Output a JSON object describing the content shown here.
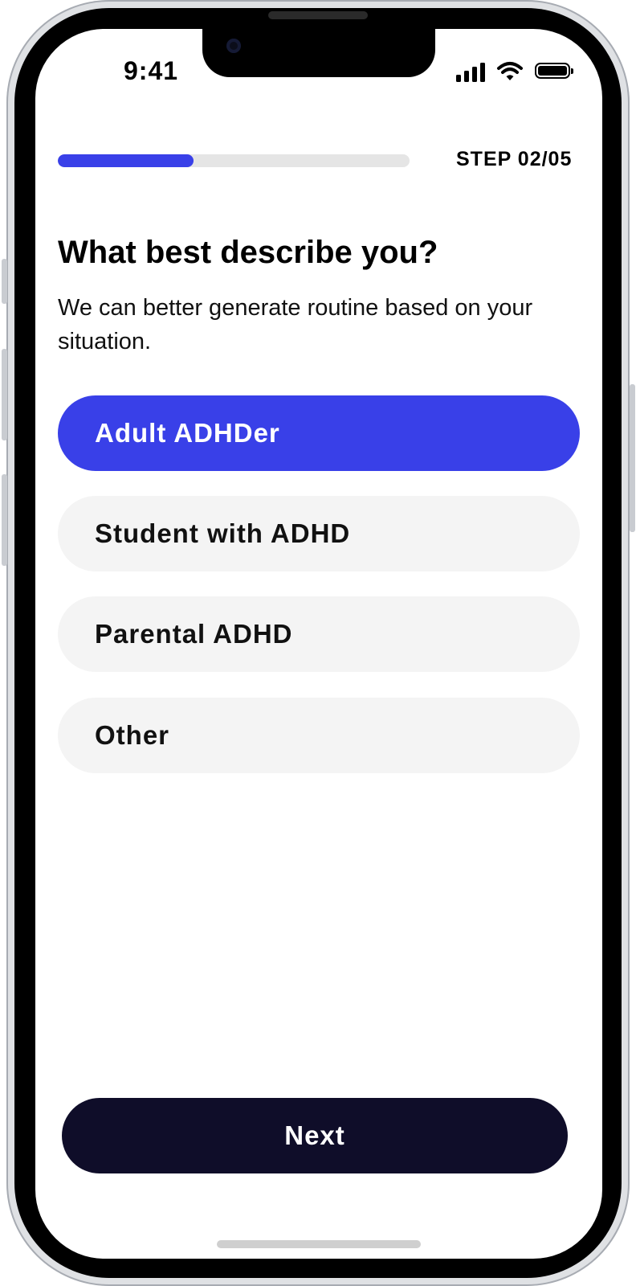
{
  "status_bar": {
    "time": "9:41"
  },
  "progress": {
    "fraction": 0.385,
    "step_label": "STEP 02/05"
  },
  "question": {
    "title": "What best describe you?",
    "subtitle": "We can better generate routine based on your situation."
  },
  "options": [
    {
      "label": "Adult ADHDer",
      "selected": true
    },
    {
      "label": "Student with ADHD",
      "selected": false
    },
    {
      "label": "Parental ADHD",
      "selected": false
    },
    {
      "label": "Other",
      "selected": false
    }
  ],
  "next_button": {
    "label": "Next"
  },
  "colors": {
    "accent": "#3940E8",
    "button_dark": "#0F0D29",
    "option_bg": "#F4F4F4",
    "track": "#E5E5E5"
  },
  "icons": [
    "cellular-signal-icon",
    "wifi-icon",
    "battery-icon"
  ]
}
